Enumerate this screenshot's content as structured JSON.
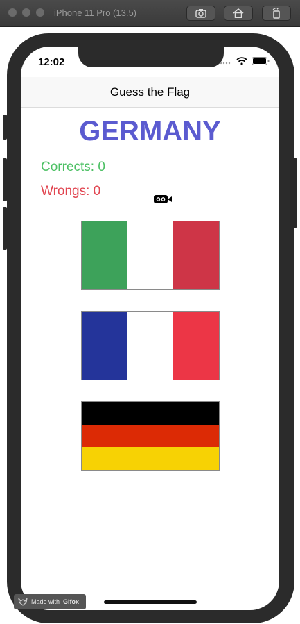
{
  "window": {
    "title": "iPhone 11 Pro (13.5)"
  },
  "status_bar": {
    "time": "12:02"
  },
  "nav": {
    "title": "Guess the Flag"
  },
  "game": {
    "country": "GERMANY",
    "corrects_text": "Corrects: 0",
    "wrongs_text": "Wrongs: 0"
  },
  "flags": [
    {
      "name": "italy-flag",
      "orientation": "vertical",
      "colors": [
        "#3da25a",
        "#ffffff",
        "#ce3547"
      ]
    },
    {
      "name": "france-flag",
      "orientation": "vertical",
      "colors": [
        "#24349a",
        "#ffffff",
        "#ec3646"
      ]
    },
    {
      "name": "germany-flag",
      "orientation": "horizontal",
      "colors": [
        "#000000",
        "#dc2a05",
        "#f7d204"
      ]
    }
  ],
  "watermark": {
    "prefix": "Made with",
    "brand": "Gifox"
  },
  "colors": {
    "country": "#5b5bd0",
    "corrects": "#4cc064",
    "wrongs": "#e14550"
  }
}
